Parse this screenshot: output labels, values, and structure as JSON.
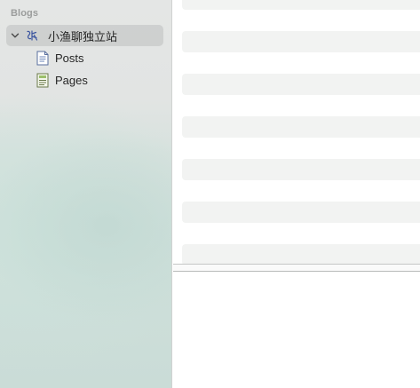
{
  "sidebar": {
    "section_header": "Blogs",
    "blog": {
      "label": "小渔聊独立站",
      "icon": "blog-glyph-icon",
      "expanded": true,
      "selected": true
    },
    "items": [
      {
        "label": "Posts",
        "icon": "document-icon"
      },
      {
        "label": "Pages",
        "icon": "pages-icon"
      }
    ]
  },
  "main": {
    "list_state": "loading",
    "placeholder_rows": 7
  },
  "colors": {
    "sidebar_selection": "#d6d8d7",
    "placeholder": "#f2f3f2",
    "pages_icon_tint": "#9bbf6a",
    "posts_icon_tint": "#6b86b8"
  }
}
